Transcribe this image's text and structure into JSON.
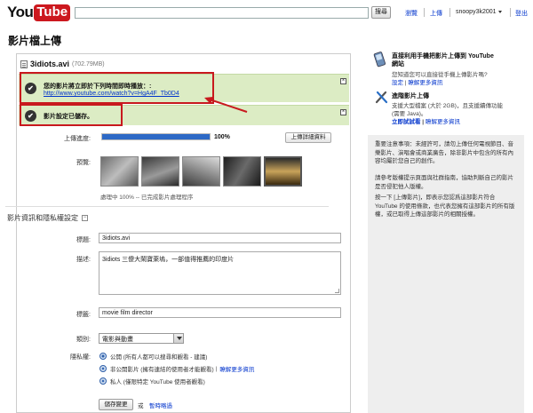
{
  "header": {
    "logo_you": "You",
    "logo_tube": "Tube",
    "search_button": "搜尋",
    "nav_browse": "瀏覽",
    "nav_upload": "上傳",
    "username": "snoopy3k2001",
    "nav_signout": "登出"
  },
  "page_title": "影片檔上傳",
  "upload": {
    "file_name": "3idiots.avi",
    "file_size": "(702.79MB)",
    "notice_title": "您的影片將立即於下列時間即時播放：:",
    "notice_link": "http://www.youtube.com/watch?v=HgA4F_Tb0D4",
    "saved_message": "影片設定已儲存。",
    "progress_label": "上傳進度:",
    "progress_fraction": 1.0,
    "progress_text": "100%",
    "detail_button": "上傳詳細資料",
    "preview_label": "預覽:",
    "processing_text": "處理中 100% -- 已完成影片處理程序"
  },
  "details": {
    "section_title": "影片資訊和隱私權設定",
    "title_label": "標題:",
    "title_value": "3idiots.avi",
    "desc_label": "描述:",
    "desc_value": "3idiots 三傻大鬧寶萊塢，一部值得推薦的印度片",
    "tags_label": "標籤:",
    "tags_value": "movie film  director",
    "category_label": "類別:",
    "category_value": "電影與動畫",
    "privacy_label": "隱私權:",
    "privacy_public": "公開 (所有人都可以搜尋和觀看 - 建議)",
    "privacy_unlisted": "非公開影片 (擁有連結的使用者才能觀看)",
    "privacy_learn_more": "瞭解更多資訊",
    "privacy_private": "私人 (僅限特定 YouTube 使用者觀看)",
    "save_button": "儲存變更",
    "or_text": "或",
    "skip_link": "暫時略過"
  },
  "sidebar": {
    "mobile_title_1": "直接利用手機把影片上傳到 YouTube",
    "mobile_title_2": "網站",
    "mobile_text": "您知道您可以直接從手機上傳影片嗎?",
    "mobile_setup": "設定",
    "mobile_sep": " | ",
    "mobile_learn": "瞭解更多資訊",
    "adv_title": "進階影片上傳",
    "adv_text_1": "支援大型檔案 (大於 2GB)，且支援續傳功能",
    "adv_text_2": "(需要 Java)。",
    "adv_try": "立即試試看",
    "adv_sep": " | ",
    "adv_learn": "瞭解更多資訊",
    "notice_1": "重要注意事項：未經許可，請勿上傳任何電視節目、音樂影片、演唱會或商業廣告，除非影片中包含的所有內容均屬於您自己的創作。",
    "notice_2": "請參考版權提示頁面與社群指南，協助判斷自己的影片是否侵犯他人版權。",
    "notice_3": "按一下 [上傳影片]，即表示您認爲這部影片符合 YouTube 的使用條款，也代表您擁有這部影片的所有版權，或已取得上傳這部影片的相關授權。"
  },
  "colors": {
    "accent_red": "#c8191e",
    "link_blue": "#0033cc",
    "success_green": "#dcecc4",
    "progress_blue": "#2d69c6"
  }
}
